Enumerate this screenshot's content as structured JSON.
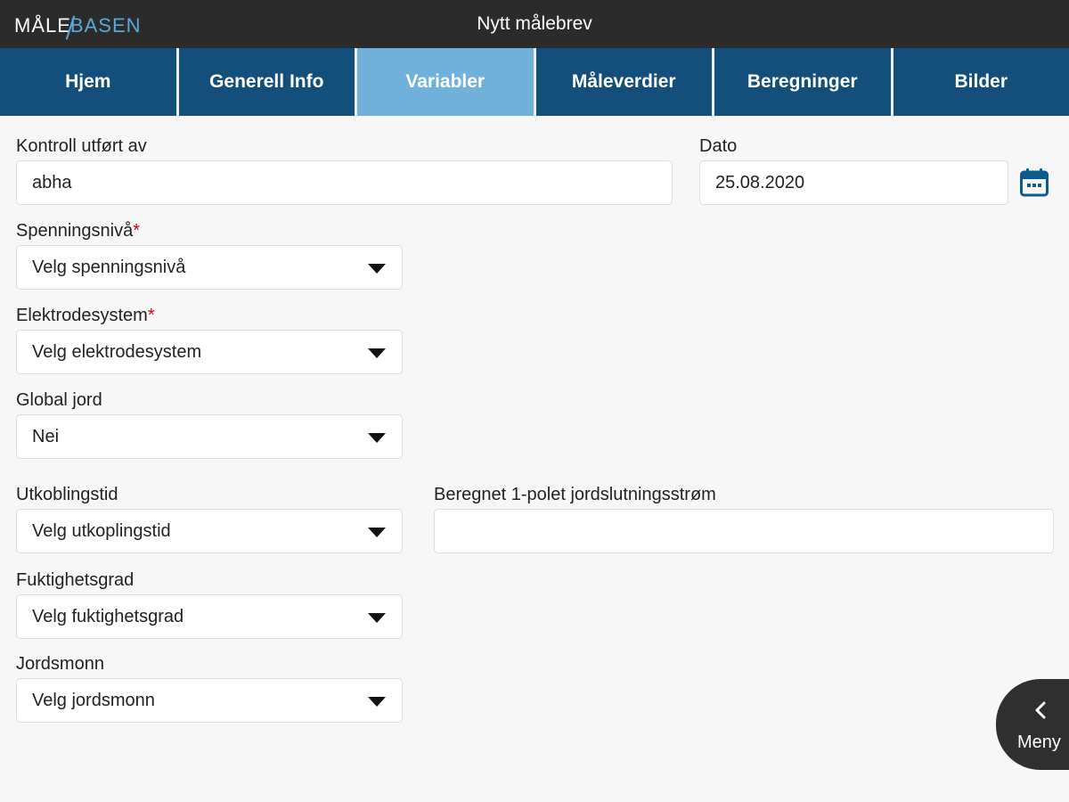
{
  "header": {
    "logo_part1": "MÅLE",
    "logo_part2": "BASEN",
    "title": "Nytt målebrev"
  },
  "tabs": [
    {
      "label": "Hjem"
    },
    {
      "label": "Generell Info"
    },
    {
      "label": "Variabler",
      "active": true
    },
    {
      "label": "Måleverdier"
    },
    {
      "label": "Beregninger"
    },
    {
      "label": "Bilder"
    }
  ],
  "form": {
    "kontroll": {
      "label": "Kontroll utført av",
      "value": "abha"
    },
    "dato": {
      "label": "Dato",
      "value": "25.08.2020"
    },
    "spenningsniva": {
      "label": "Spenningsnivå",
      "required_mark": "*",
      "value": "Velg spenningsnivå"
    },
    "elektrodesystem": {
      "label": "Elektrodesystem",
      "required_mark": "*",
      "value": "Velg elektrodesystem"
    },
    "global_jord": {
      "label": "Global jord",
      "value": "Nei"
    },
    "utkoblingstid": {
      "label": "Utkoblingstid",
      "value": "Velg utkoplingstid"
    },
    "beregnet": {
      "label": "Beregnet 1-polet jordslutningsstrøm",
      "value": ""
    },
    "fuktighetsgrad": {
      "label": "Fuktighetsgrad",
      "value": "Velg fuktighetsgrad"
    },
    "jordsmonn": {
      "label": "Jordsmonn",
      "value": "Velg jordsmonn"
    }
  },
  "menu": {
    "label": "Meny",
    "icon": "chevron-left-icon"
  },
  "colors": {
    "topbar": "#2b2b2b",
    "tab_bg": "#134f7a",
    "tab_active": "#6fb1da",
    "logo_accent": "#5aa8d8",
    "required": "#d0021b",
    "calendar_icon": "#0d5a8e"
  }
}
